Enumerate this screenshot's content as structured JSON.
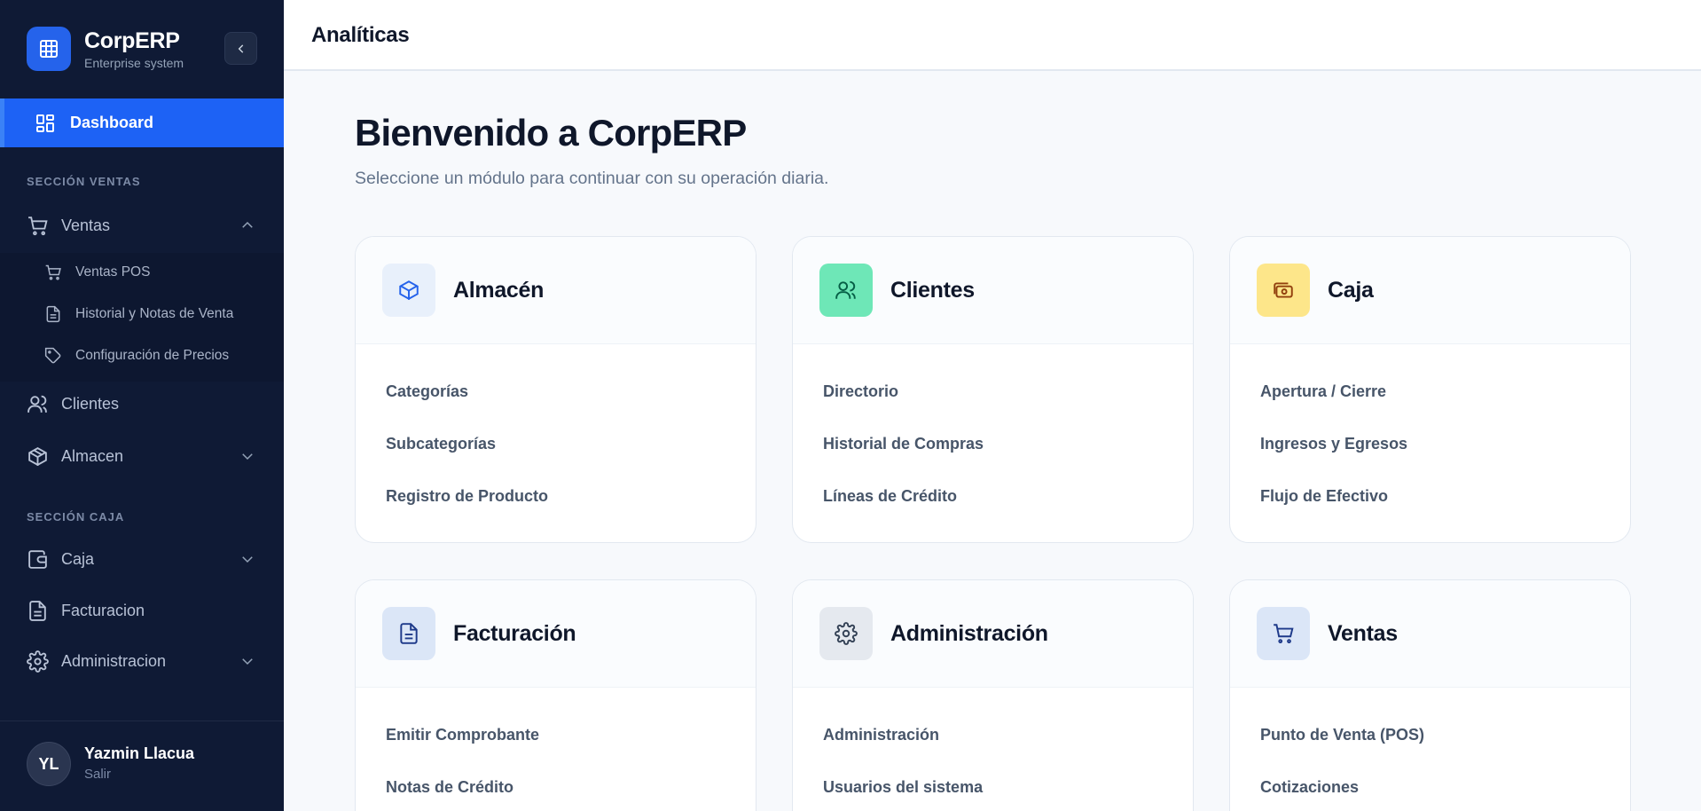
{
  "brand": {
    "name": "CorpERP",
    "subtitle": "Enterprise system"
  },
  "sidebar": {
    "dashboard": "Dashboard",
    "section_sales": "SECCIÓN VENTAS",
    "ventas": "Ventas",
    "ventas_sub": [
      "Ventas POS",
      "Historial y Notas de Venta",
      "Configuración de Precios"
    ],
    "clientes": "Clientes",
    "almacen": "Almacen",
    "section_cash": "SECCIÓN CAJA",
    "caja": "Caja",
    "facturacion": "Facturacion",
    "administracion": "Administracion"
  },
  "user": {
    "initials": "YL",
    "name": "Yazmin Llacua",
    "logout": "Salir"
  },
  "header": {
    "title": "Analíticas"
  },
  "main": {
    "title": "Bienvenido a CorpERP",
    "subtitle": "Seleccione un módulo para continuar con su operación diaria."
  },
  "cards": [
    {
      "title": "Almacén",
      "icon": "box-icon",
      "icon_bg": "#e8f0fb",
      "links": [
        "Categorías",
        "Subcategorías",
        "Registro de Producto"
      ]
    },
    {
      "title": "Clientes",
      "icon": "users-icon",
      "icon_bg": "#6ee7b7",
      "links": [
        "Directorio",
        "Historial de Compras",
        "Líneas de Crédito"
      ]
    },
    {
      "title": "Caja",
      "icon": "cash-icon",
      "icon_bg": "#fde68a",
      "links": [
        "Apertura / Cierre",
        "Ingresos y Egresos",
        "Flujo de Efectivo"
      ]
    },
    {
      "title": "Facturación",
      "icon": "document-icon",
      "icon_bg": "#dbe6f7",
      "links": [
        "Emitir Comprobante",
        "Notas de Crédito"
      ]
    },
    {
      "title": "Administración",
      "icon": "gear-icon",
      "icon_bg": "#e5e9ef",
      "links": [
        "Administración",
        "Usuarios del sistema"
      ]
    },
    {
      "title": "Ventas",
      "icon": "cart-icon",
      "icon_bg": "#dbe6f7",
      "links": [
        "Punto de Venta (POS)",
        "Cotizaciones"
      ]
    }
  ],
  "colors": {
    "sidebar_bg": "#0f1a35",
    "accent": "#1d62f5"
  }
}
